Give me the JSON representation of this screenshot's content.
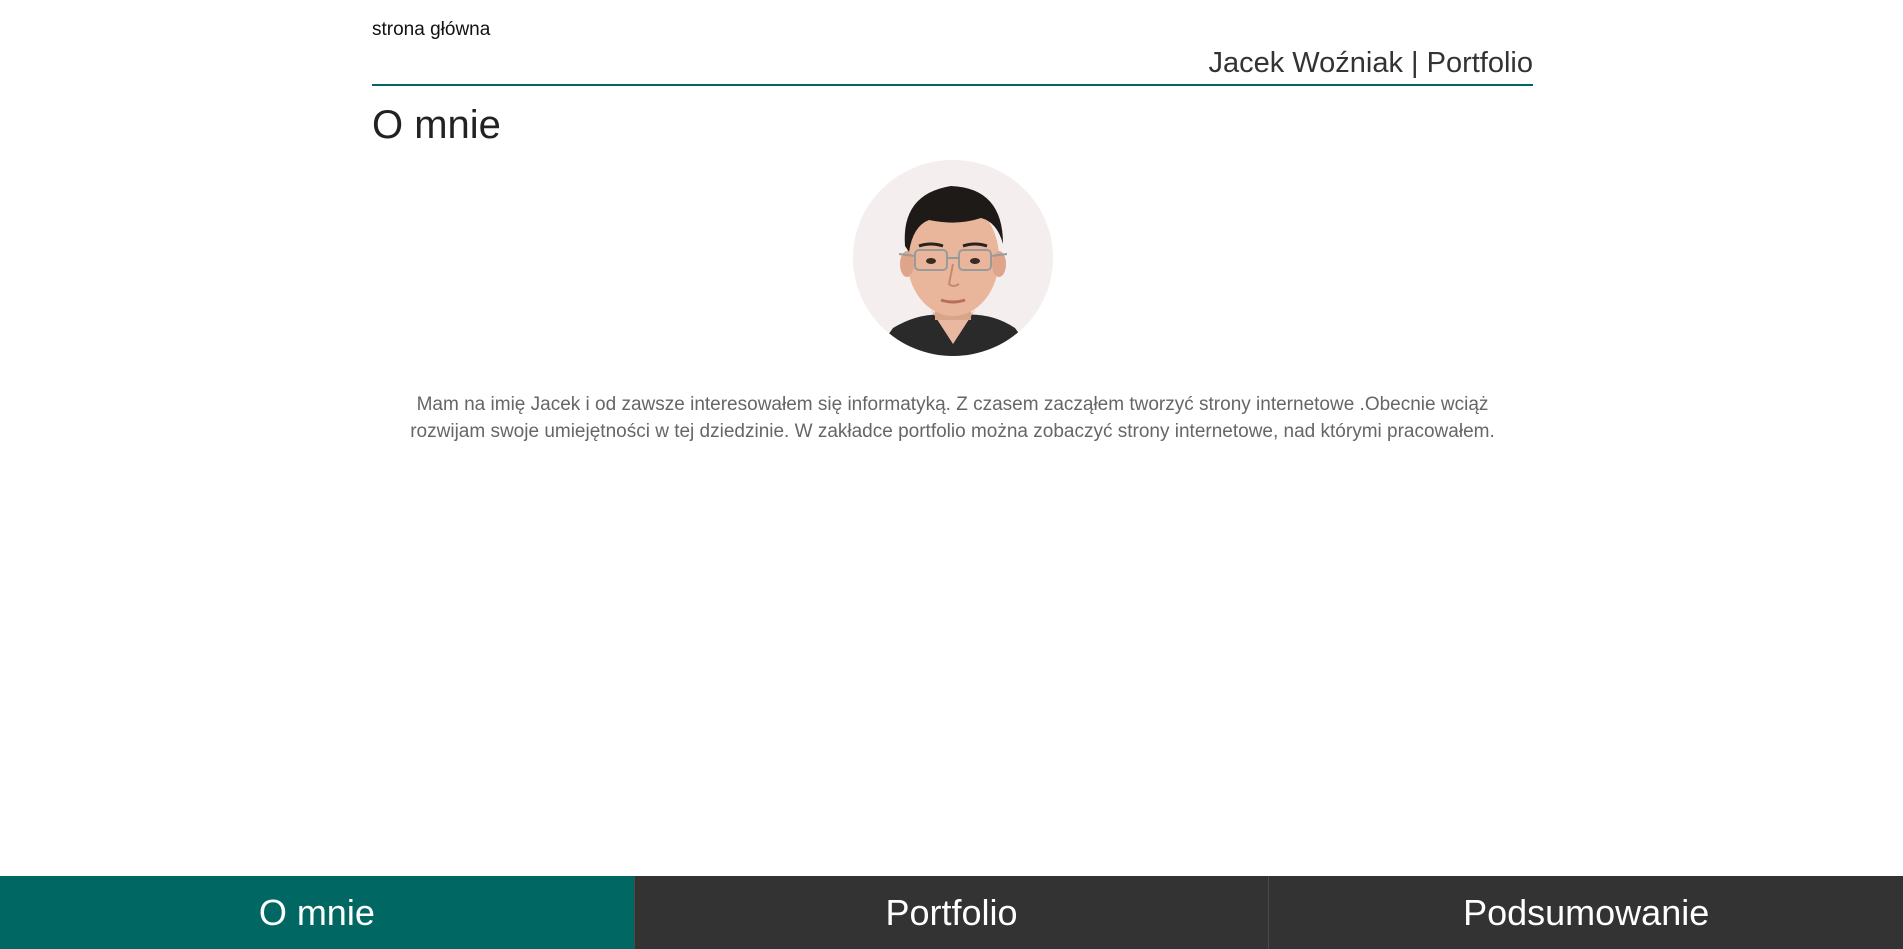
{
  "header": {
    "home_link": "strona główna",
    "site_title": "Jacek Woźniak | Portfolio"
  },
  "colors": {
    "accent": "#006763",
    "nav_background": "#333333",
    "text_muted": "#666666"
  },
  "main": {
    "heading": "O mnie",
    "about_lines": [
      "Mam na imię Jacek i od zawsze interesowałem się informatyką. Z czasem zacząłem tworzyć strony internetowe .Obecnie wciąż",
      "rozwijam swoje umiejętności w tej dziedzinie. W zakładce portfolio można zobaczyć strony internetowe, nad którymi pracowałem."
    ]
  },
  "nav": {
    "items": [
      {
        "label": "O mnie",
        "active": true
      },
      {
        "label": "Portfolio",
        "active": false
      },
      {
        "label": "Podsumowanie",
        "active": false
      }
    ]
  }
}
